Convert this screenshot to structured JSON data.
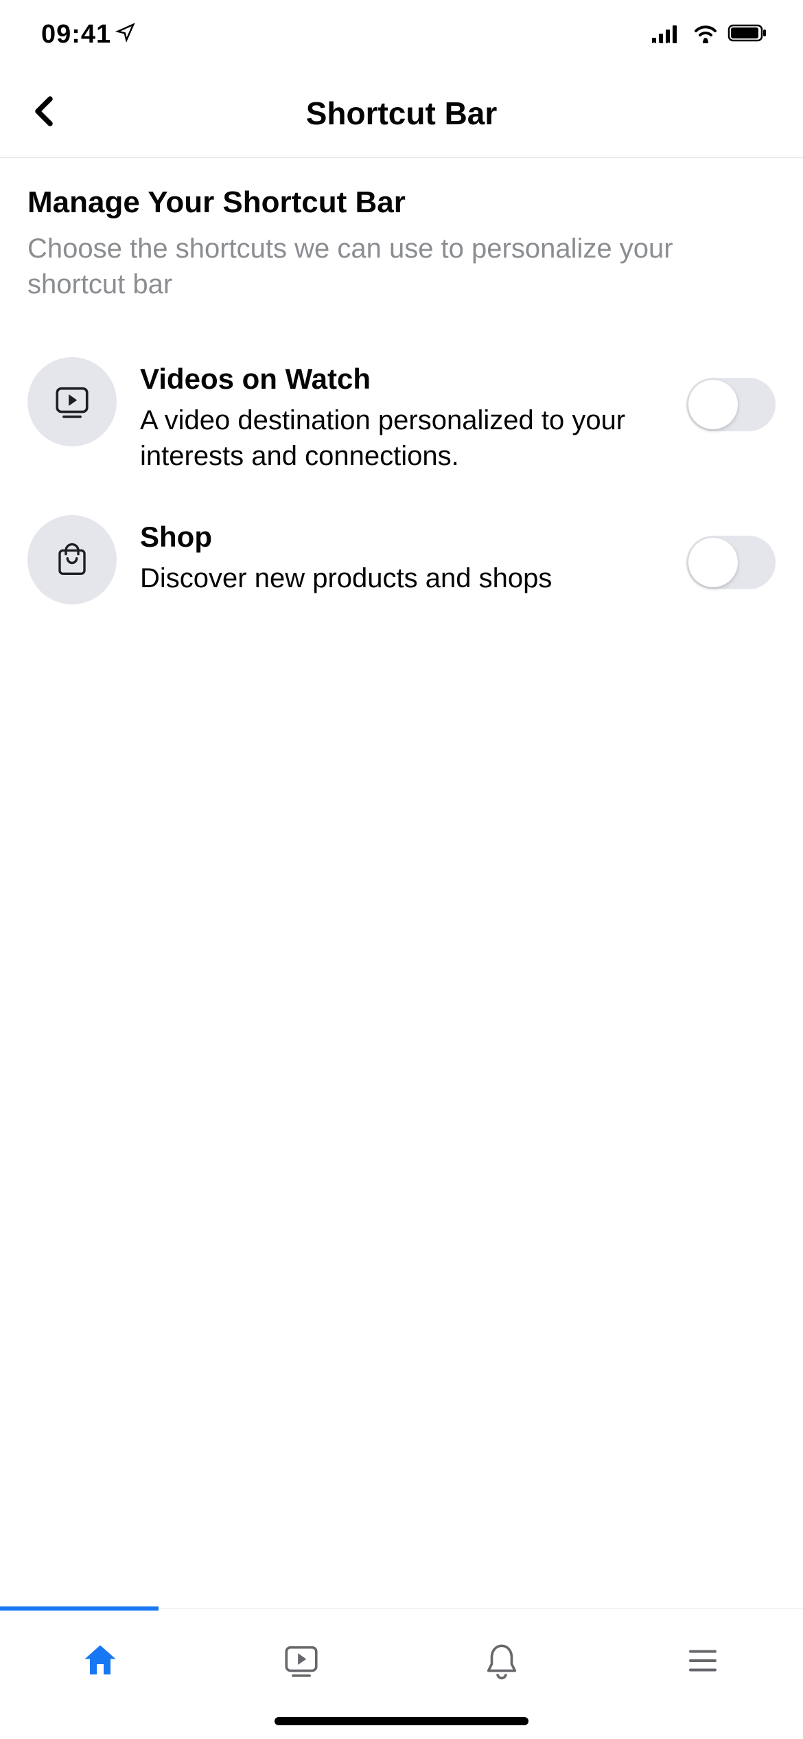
{
  "statusBar": {
    "time": "09:41"
  },
  "navHeader": {
    "title": "Shortcut Bar"
  },
  "section": {
    "title": "Manage Your Shortcut Bar",
    "subtitle": "Choose the shortcuts we can use to personalize your shortcut bar"
  },
  "options": [
    {
      "title": "Videos on Watch",
      "description": "A video destination personalized to your interests and connections.",
      "toggled": false
    },
    {
      "title": "Shop",
      "description": "Discover new products and shops",
      "toggled": false
    }
  ]
}
